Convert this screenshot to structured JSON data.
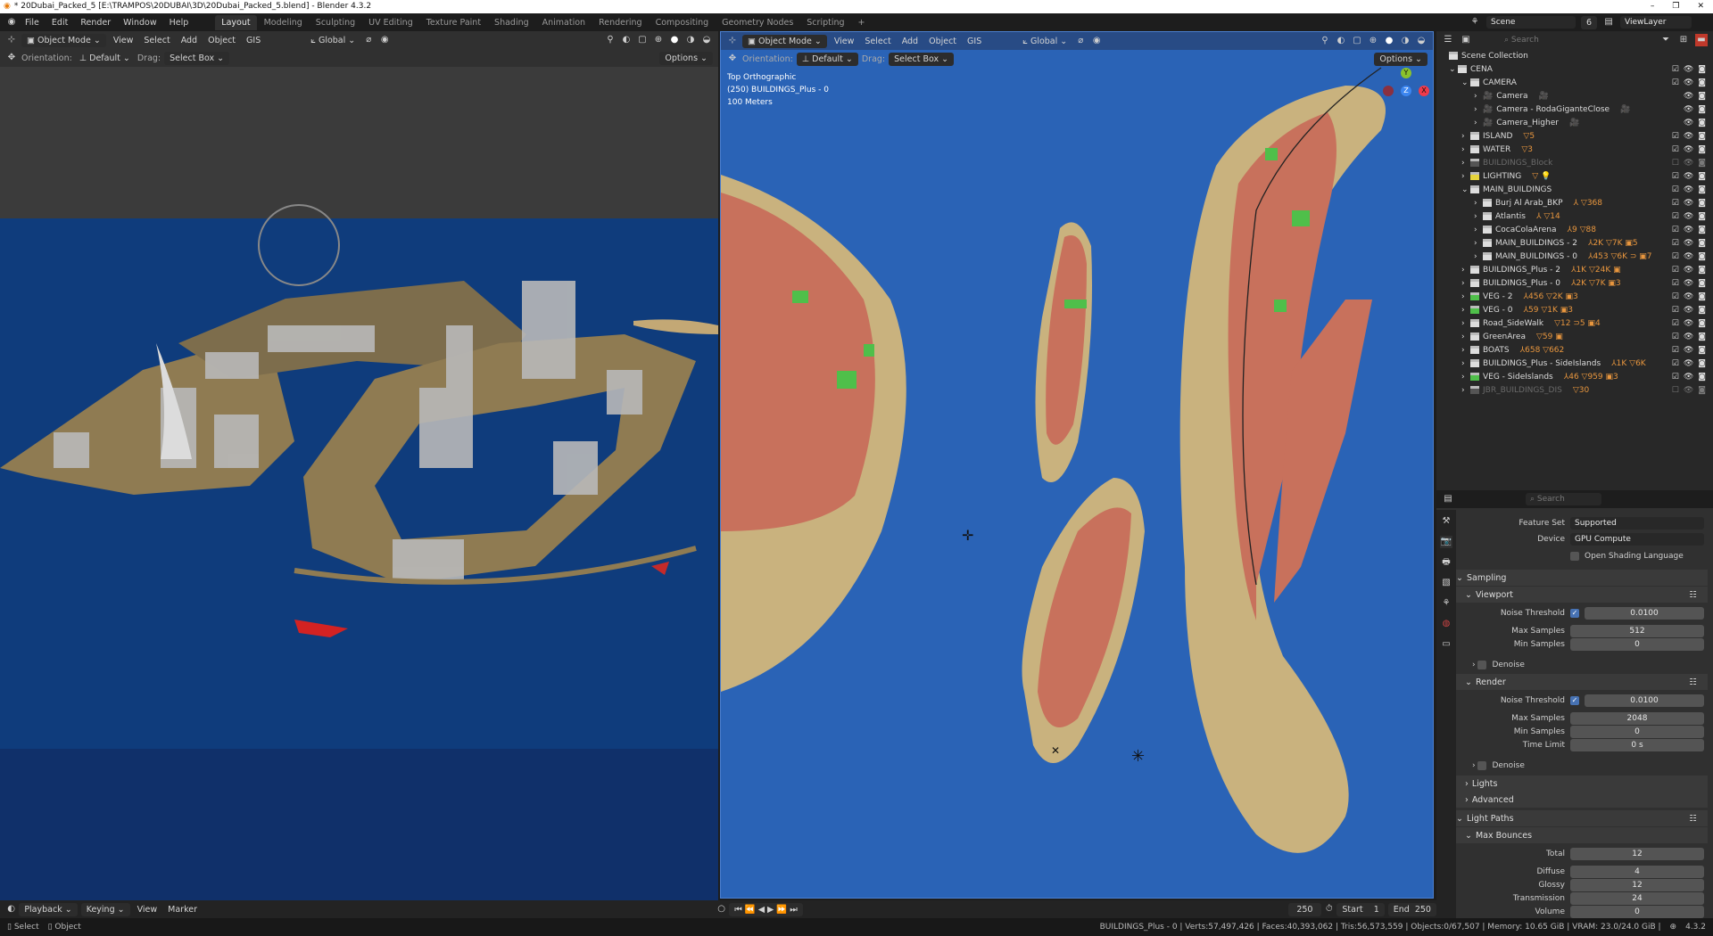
{
  "window": {
    "title": "* 20Dubai_Packed_5 [E:\\TRAMPOS\\20DUBAI\\3D\\20Dubai_Packed_5.blend] - Blender 4.3.2"
  },
  "menu": [
    "File",
    "Edit",
    "Render",
    "Window",
    "Help"
  ],
  "workspaces": [
    {
      "label": "Layout",
      "active": true
    },
    {
      "label": "Modeling"
    },
    {
      "label": "Sculpting"
    },
    {
      "label": "UV Editing"
    },
    {
      "label": "Texture Paint"
    },
    {
      "label": "Shading"
    },
    {
      "label": "Animation"
    },
    {
      "label": "Rendering"
    },
    {
      "label": "Compositing"
    },
    {
      "label": "Geometry Nodes"
    },
    {
      "label": "Scripting"
    },
    {
      "label": "+"
    }
  ],
  "viewport_header": {
    "mode": "Object Mode",
    "menus": [
      "View",
      "Select",
      "Add",
      "Object",
      "GIS"
    ],
    "transform": "Global",
    "orientation_label": "Orientation:",
    "orientation": "Default",
    "drag_label": "Drag:",
    "drag": "Select Box",
    "options": "Options"
  },
  "viewport_right": {
    "view_name": "Top Orthographic",
    "object": "(250) BUILDINGS_Plus - 0",
    "scale": "100 Meters",
    "gizmo": {
      "y": "Y",
      "z": "Z",
      "x": "X"
    }
  },
  "colors": {
    "water_left": "#0f3c7c",
    "water_right": "#2a63b6",
    "sand": "#c9b27e",
    "plots": "#c8715c",
    "accent": "#4772b3"
  },
  "outliner": {
    "scene": "Scene",
    "scene_count": "6",
    "view_layer": "ViewLayer",
    "search_placeholder": "Search",
    "root": "Scene Collection",
    "items": [
      {
        "name": "CENA",
        "depth": 0,
        "open": true,
        "badges": ""
      },
      {
        "name": "CAMERA",
        "depth": 1,
        "open": true,
        "badges": ""
      },
      {
        "name": "Camera",
        "depth": 2,
        "type": "camera",
        "badges": "🎥"
      },
      {
        "name": "Camera - RodaGiganteClose",
        "depth": 2,
        "type": "camera",
        "badges": "🎥"
      },
      {
        "name": "Camera_Higher",
        "depth": 2,
        "type": "camera",
        "badges": "🎥"
      },
      {
        "name": "ISLAND",
        "depth": 1,
        "badges": "▽5"
      },
      {
        "name": "WATER",
        "depth": 1,
        "badges": "▽3"
      },
      {
        "name": "BUILDINGS_Block",
        "depth": 1,
        "dim": true,
        "badges": ""
      },
      {
        "name": "LIGHTING",
        "depth": 1,
        "badges": "▽ 💡"
      },
      {
        "name": "MAIN_BUILDINGS",
        "depth": 1,
        "open": true,
        "badges": ""
      },
      {
        "name": "Burj Al Arab_BKP",
        "depth": 2,
        "badges": "⅄ ▽368"
      },
      {
        "name": "Atlantis",
        "depth": 2,
        "badges": "⅄ ▽14"
      },
      {
        "name": "CocaColaArena",
        "depth": 2,
        "badges": "⅄9 ▽88"
      },
      {
        "name": "MAIN_BUILDINGS - 2",
        "depth": 2,
        "badges": "⅄2K ▽7K ▣5"
      },
      {
        "name": "MAIN_BUILDINGS - 0",
        "depth": 2,
        "badges": "⅄453 ▽6K ⊃ ▣7"
      },
      {
        "name": "BUILDINGS_Plus - 2",
        "depth": 1,
        "badges": "⅄1K ▽24K ▣"
      },
      {
        "name": "BUILDINGS_Plus - 0",
        "depth": 1,
        "badges": "⅄2K ▽7K ▣3"
      },
      {
        "name": "VEG - 2",
        "depth": 1,
        "veg": true,
        "badges": "⅄456 ▽2K ▣3"
      },
      {
        "name": "VEG - 0",
        "depth": 1,
        "veg": true,
        "badges": "⅄59 ▽1K ▣3"
      },
      {
        "name": "Road_SideWalk",
        "depth": 1,
        "badges": "▽12 ⊃5 ▣4"
      },
      {
        "name": "GreenArea",
        "depth": 1,
        "badges": "▽59 ▣"
      },
      {
        "name": "BOATS",
        "depth": 1,
        "badges": "⅄658 ▽662"
      },
      {
        "name": "BUILDINGS_Plus - SideIslands",
        "depth": 1,
        "badges": "⅄1K ▽6K"
      },
      {
        "name": "VEG - SideIslands",
        "depth": 1,
        "veg": true,
        "badges": "⅄46 ▽959 ▣3"
      },
      {
        "name": "JBR_BUILDINGS_DIS",
        "depth": 1,
        "dim": true,
        "badges": "▽30"
      }
    ]
  },
  "properties": {
    "search_placeholder": "Search",
    "feature_set": {
      "label": "Feature Set",
      "value": "Supported"
    },
    "device": {
      "label": "Device",
      "value": "GPU Compute"
    },
    "osl": "Open Shading Language",
    "sampling": "Sampling",
    "viewport": "Viewport",
    "render": "Render",
    "noise_threshold": "Noise Threshold",
    "max_samples": "Max Samples",
    "min_samples": "Min Samples",
    "time_limit": "Time Limit",
    "vp_noise": "0.0100",
    "vp_max": "512",
    "vp_min": "0",
    "denoise": "Denoise",
    "r_noise": "0.0100",
    "r_max": "2048",
    "r_min": "0",
    "r_time": "0 s",
    "lights": "Lights",
    "advanced": "Advanced",
    "light_paths": "Light Paths",
    "max_bounces": "Max Bounces",
    "bounces": [
      {
        "label": "Total",
        "value": "12"
      },
      {
        "label": "Diffuse",
        "value": "4"
      },
      {
        "label": "Glossy",
        "value": "12"
      },
      {
        "label": "Transmission",
        "value": "24"
      },
      {
        "label": "Volume",
        "value": "0"
      }
    ]
  },
  "timeline": {
    "menus": [
      "Playback",
      "Keying",
      "View",
      "Marker"
    ],
    "current": "250",
    "start_label": "Start",
    "start": "1",
    "end_label": "End",
    "end": "250"
  },
  "status": {
    "select": "Select",
    "object": "Object",
    "stats": "BUILDINGS_Plus - 0 | Verts:57,497,426 | Faces:40,393,062 | Tris:56,573,559 | Objects:0/67,507 | Memory: 10.65 GiB | VRAM: 23.0/24.0 GiB |",
    "version": "4.3.2"
  }
}
